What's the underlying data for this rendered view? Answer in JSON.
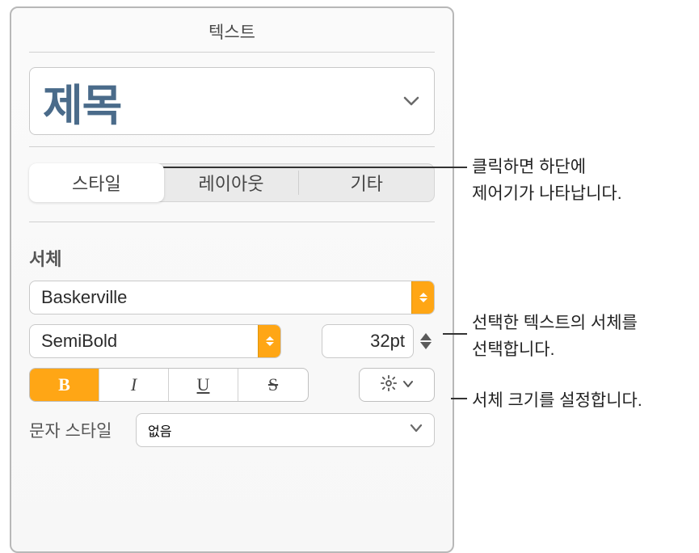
{
  "panel": {
    "title": "텍스트"
  },
  "paragraph_style": {
    "selected": "제목"
  },
  "tabs": {
    "items": [
      "스타일",
      "레이아웃",
      "기타"
    ],
    "active_index": 0
  },
  "font_section": {
    "label": "서체",
    "family": "Baskerville",
    "weight": "SemiBold",
    "size": "32pt",
    "format": {
      "bold": "B",
      "italic": "I",
      "underline": "U",
      "strike": "S",
      "bold_active": true
    }
  },
  "character_style": {
    "label": "문자 스타일",
    "value": "없음"
  },
  "callouts": {
    "c1": "클릭하면 하단에\n제어기가 나타납니다.",
    "c2": "선택한 텍스트의 서체를\n선택합니다.",
    "c3": "서체 크기를 설정합니다."
  }
}
